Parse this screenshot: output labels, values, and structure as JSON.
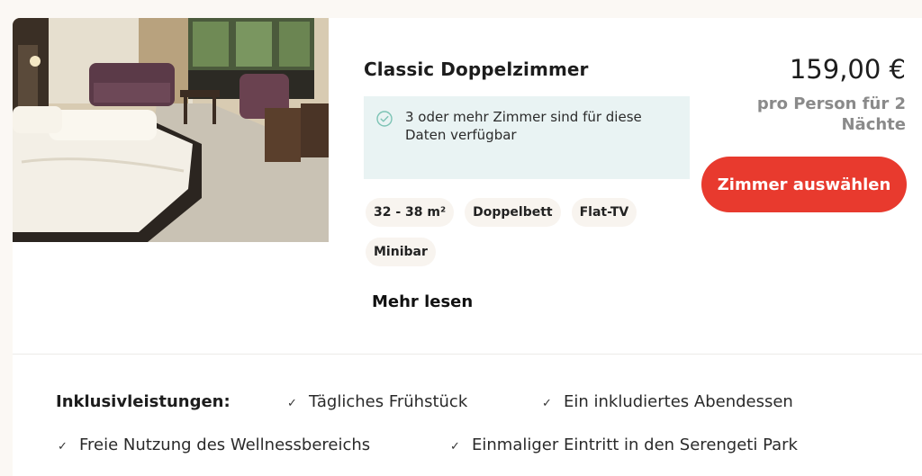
{
  "room": {
    "title": "Classic Doppelzimmer",
    "availability": "3 oder mehr Zimmer sind für diese Daten verfügbar",
    "tags": [
      "32 - 38 m²",
      "Doppelbett",
      "Flat-TV",
      "Minibar"
    ],
    "more_label": "Mehr lesen"
  },
  "pricing": {
    "price": "159,00 €",
    "note": "pro Person für 2 Nächte",
    "select_label": "Zimmer auswählen"
  },
  "inclusions": {
    "label": "Inklusivleistungen:",
    "items": [
      "Tägliches Frühstück",
      "Ein inkludiertes Abendessen",
      "Freie Nutzung des Wellnessbereichs",
      "Einmaliger Eintritt in den Serengeti Park"
    ]
  },
  "colors": {
    "accent": "#e83a2e",
    "availability_bg": "#e9f3f3",
    "tag_bg": "#f8f4ef",
    "check_icon": "#7cc3b4"
  },
  "icons": {
    "availability": "check-circle-icon",
    "inclusion": "checkmark-icon"
  }
}
